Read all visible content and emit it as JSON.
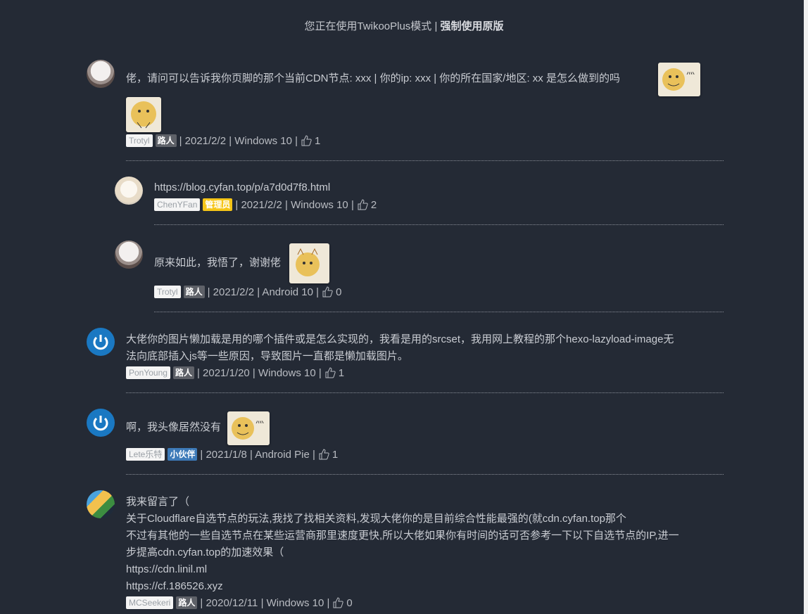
{
  "mode_bar": {
    "prefix": "您正在使用TwikooPlus模式 | ",
    "action": "强制使用原版"
  },
  "comments": [
    {
      "text": "佬，请问可以告诉我你页脚的那个当前CDN节点: xxx | 你的ip: xxx | 你的所在国家/地区: xx 是怎么做到的吗",
      "nick": "Trotyl",
      "tag": "路人",
      "meta": "| 2021/2/2 | Windows 10 |",
      "likes": "1"
    },
    {
      "text": "https://blog.cyfan.top/p/a7d0d7f8.html",
      "nick": "ChenYFan",
      "tag": "管理员",
      "meta": "| 2021/2/2 | Windows 10 |",
      "likes": "2"
    },
    {
      "text": "原来如此，我悟了，谢谢佬",
      "nick": "Trotyl",
      "tag": "路人",
      "meta": "| 2021/2/2 | Android 10 |",
      "likes": "0"
    },
    {
      "text_line1": "大佬你的图片懒加载是用的哪个插件或是怎么实现的，我看是用的srcset，我用网上教程的那个hexo-lazyload-image无",
      "text_line2": "法向底部插入js等一些原因，导致图片一直都是懒加载图片。",
      "nick": "PonYoung",
      "tag": "路人",
      "meta": "| 2021/1/20 | Windows 10 |",
      "likes": "1"
    },
    {
      "text": "啊，我头像居然没有",
      "nick": "Lete乐特",
      "tag": "小伙伴",
      "meta": "| 2021/1/8 | Android Pie |",
      "likes": "1"
    },
    {
      "lines": [
        "我来留言了（",
        "关于Cloudflare自选节点的玩法,我找了找相关资料,发现大佬你的是目前综合性能最强的(就cdn.cyfan.top那个",
        "不过有其他的一些自选节点在某些运营商那里速度更快,所以大佬如果你有时间的话可否参考一下以下自选节点的IP,进一",
        "步提高cdn.cyfan.top的加速效果（",
        "https://cdn.linil.ml",
        "https://cf.186526.xyz"
      ],
      "nick": "MCSeekeri",
      "tag": "路人",
      "meta": "| 2020/12/11 | Windows 10 |",
      "likes": "0"
    }
  ],
  "colors": {
    "background": "#242a35",
    "text": "#c9ccd2",
    "admin_tag": "#f5c518",
    "partner_tag": "#3d7ab8",
    "guest_tag": "#5e6168"
  }
}
